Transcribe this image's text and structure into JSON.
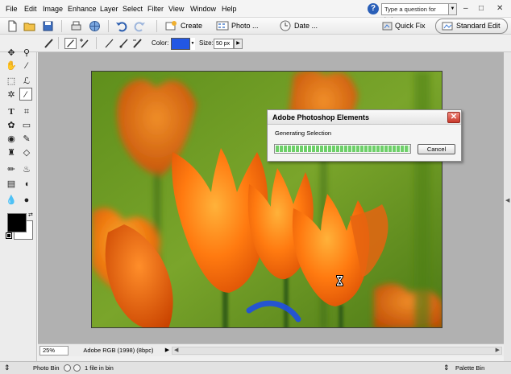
{
  "menubar": {
    "items": [
      "File",
      "Edit",
      "Image",
      "Enhance",
      "Layer",
      "Select",
      "Filter",
      "View",
      "Window",
      "Help"
    ],
    "help_search_placeholder": "Type a question for help",
    "window_controls": [
      "–",
      "□",
      "✕"
    ]
  },
  "shortcuts": {
    "create_label": "Create",
    "photo_label": "Photo ...",
    "date_label": "Date ...",
    "quick_fix_label": "Quick Fix",
    "standard_edit_label": "Standard Edit"
  },
  "options": {
    "color_label": "Color:",
    "color_value": "#2257e4",
    "size_label": "Size:",
    "size_value": "50 px"
  },
  "dialog": {
    "title": "Adobe Photoshop Elements",
    "message": "Generating Selection",
    "progress": 1.0,
    "cancel_label": "Cancel",
    "close_glyph": "✕"
  },
  "statusbar": {
    "zoom": "25%",
    "color_profile": "Adobe RGB (1998) (8bpc)"
  },
  "bottombar": {
    "photo_bin_label": "Photo Bin",
    "file_count_label": "1 file in bin",
    "palette_bin_label": "Palette Bin"
  },
  "colors": {
    "foreground": "#000000",
    "background": "#ffffff",
    "accent": "#2257e4"
  }
}
